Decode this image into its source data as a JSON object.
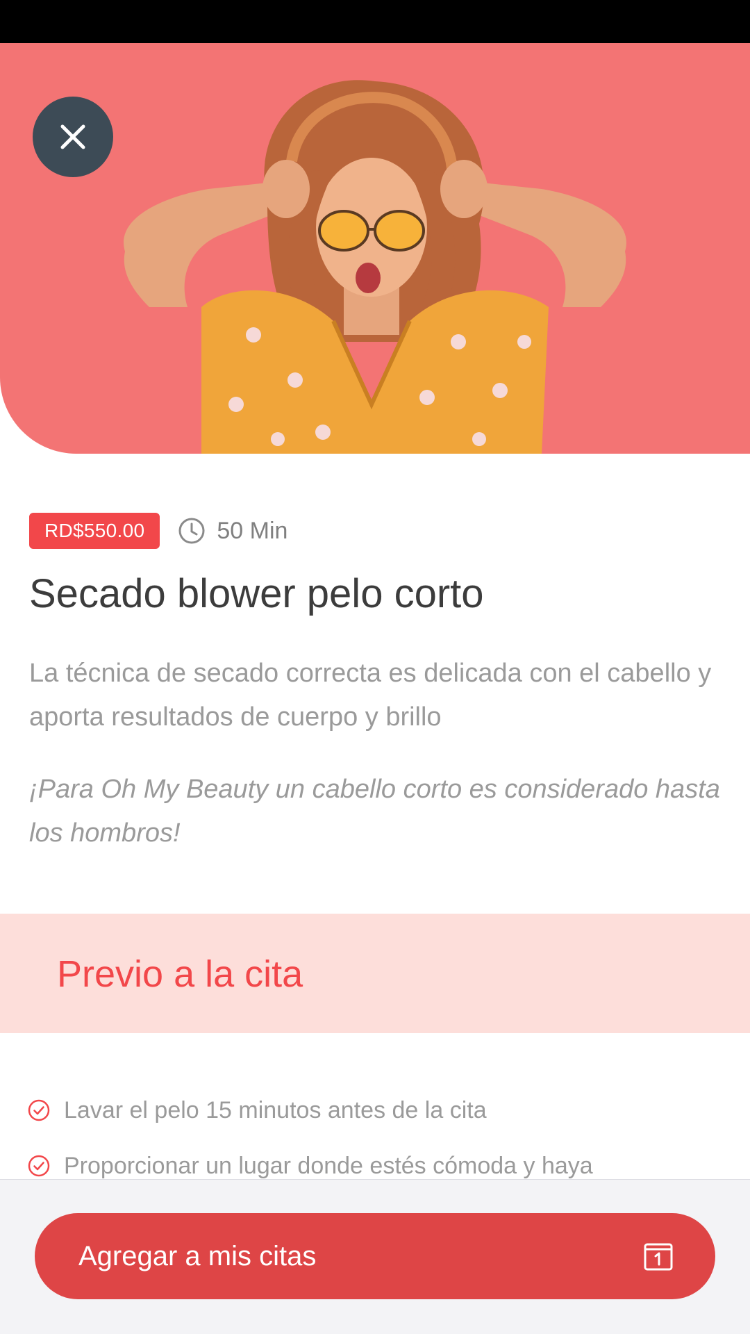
{
  "service": {
    "price": "RD$550.00",
    "duration": "50 Min",
    "title": "Secado blower pelo corto",
    "description": "La técnica de secado correcta es delicada con el cabello y aporta resultados de cuerpo y brillo",
    "note": "¡Para Oh My Beauty un cabello corto es considerado hasta los hombros!"
  },
  "section": {
    "title": "Previo a la cita"
  },
  "checklist": [
    "Lavar el pelo 15 minutos antes de la cita",
    "Proporcionar un lugar donde estés cómoda y haya"
  ],
  "cta": {
    "label": "Agregar a mis citas",
    "icon": "calendar-icon"
  },
  "icons": {
    "close": "close-icon",
    "duration": "clock-icon",
    "check": "check-circle-icon"
  },
  "colors": {
    "hero_background": "#f37474",
    "accent": "#f2474a",
    "cta_background": "#de4546",
    "section_background": "#fddeda",
    "close_button": "#3d4b56"
  }
}
